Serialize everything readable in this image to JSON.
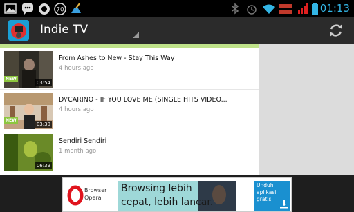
{
  "statusbar": {
    "clock": "01:13",
    "notif_badge": "70"
  },
  "actionbar": {
    "title": "Indie TV"
  },
  "videos": [
    {
      "title": "From Ashes to New - Stay This Way",
      "time": "4 hours ago",
      "duration": "03:54",
      "badge": "NEW"
    },
    {
      "title": "D\\'CARINO - IF YOU LOVE ME (SINGLE HITS VIDEO...",
      "time": "4 hours ago",
      "duration": "03:30",
      "badge": "NEW"
    },
    {
      "title": "Sendiri Sendiri",
      "time": "1 month ago",
      "duration": "06:39",
      "badge": ""
    }
  ],
  "ad": {
    "brand_line1": "Browser",
    "brand_line2": "Opera",
    "headline_line1": "Browsing lebih",
    "headline_line2": "cepat, lebih lancar.",
    "cta_line1": "Unduh",
    "cta_line2": "aplikasi",
    "cta_line3": "gratis"
  },
  "colors": {
    "accent": "#33b5e5",
    "new_badge": "#8cc63f",
    "green_bar": "#bfe28a"
  }
}
